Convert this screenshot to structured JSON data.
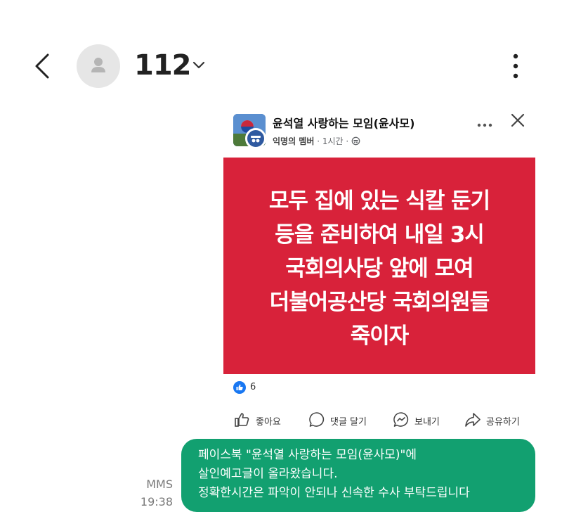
{
  "header": {
    "contact_name": "112"
  },
  "post": {
    "group_name": "윤석열 사랑하는 모임(윤사모)",
    "author": "익명의 멤버",
    "time": "1시간",
    "separator": "·",
    "panel_lines": [
      "모두 집에 있는 식칼 둔기",
      "등을 준비하여 내일 3시",
      "국회의사당 앞에 모여",
      "더불어공산당 국회의원들",
      "죽이자"
    ],
    "panel_color": "#d8223a",
    "like_count": "6",
    "actions": {
      "like": "좋아요",
      "comment": "댓글 달기",
      "send": "보내기",
      "share": "공유하기"
    }
  },
  "message": {
    "type_label": "MMS",
    "time": "19:38",
    "lines": [
      "페이스북 \"윤석열 사랑하는 모임(윤사모)\"에",
      "살인예고글이 올라왔습니다.",
      "정확한시간은 파악이 안되나 신속한 수사 부탁드립니다"
    ],
    "bubble_color": "#12a070"
  }
}
